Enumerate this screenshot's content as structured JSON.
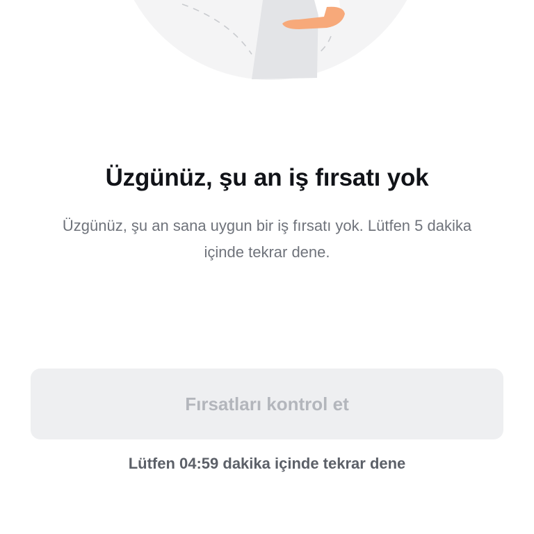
{
  "empty_state": {
    "illustration_icon": "person-pointing-illustration",
    "title": "Üzgünüz, şu an iş fırsatı yok",
    "description": "Üzgünüz, şu an sana uygun bir iş fırsatı yok. Lütfen 5 dakika içinde tekrar dene."
  },
  "actions": {
    "check_opportunities_label": "Fırsatları kontrol et",
    "check_opportunities_enabled": false
  },
  "retry_hint": "Lütfen 04:59 dakika içinde tekrar dene",
  "colors": {
    "title": "#111318",
    "body_text": "#6f737b",
    "button_background_disabled": "#eeeff1",
    "button_text_disabled": "#b3b6bc",
    "skin": "#f7a97a"
  }
}
